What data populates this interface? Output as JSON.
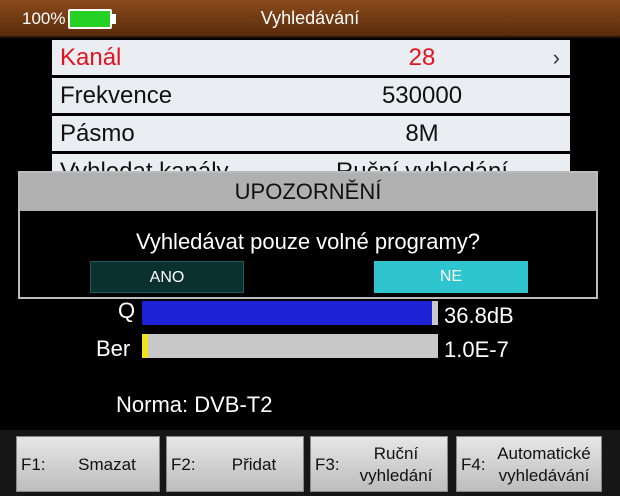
{
  "status": {
    "battery_pct": "100%",
    "battery_level": 1.0
  },
  "title": "Vyhledávání",
  "menu": {
    "items": [
      {
        "label": "Kanál",
        "value": "28",
        "arrow": "›",
        "selected": true
      },
      {
        "label": "Frekvence",
        "value": "530000"
      },
      {
        "label": "Pásmo",
        "value": "8M"
      },
      {
        "label": "Vyhledat kanály",
        "value": "Ruční vyhledání"
      }
    ]
  },
  "dialog": {
    "title": "UPOZORNĚNÍ",
    "message": "Vyhledávat pouze volné programy?",
    "yes_label": "ANO",
    "no_label": "NE",
    "selected": "NE"
  },
  "signal": {
    "q_label": "Q",
    "q_value": "36.8dB",
    "q_level": 0.98,
    "ber_label": "Ber",
    "ber_value": "1.0E-7",
    "ber_level": 0.02
  },
  "norma": "Norma: DVB-T2",
  "fkeys": [
    {
      "num": "F1:",
      "label": "Smazat"
    },
    {
      "num": "F2:",
      "label": "Přidat"
    },
    {
      "num": "F3:",
      "label_line1": "Ruční",
      "label_line2": "vyhledání"
    },
    {
      "num": "F4:",
      "label_line1": "Automatické",
      "label_line2": "vyhledávání"
    }
  ],
  "colors": {
    "topbar": "#8a4a1a",
    "selected_text": "#e0141e",
    "q_bar": "#1c22d6",
    "ber_bar": "#f2e21a",
    "dialog_no": "#2ec5cf",
    "battery": "#25d125"
  }
}
